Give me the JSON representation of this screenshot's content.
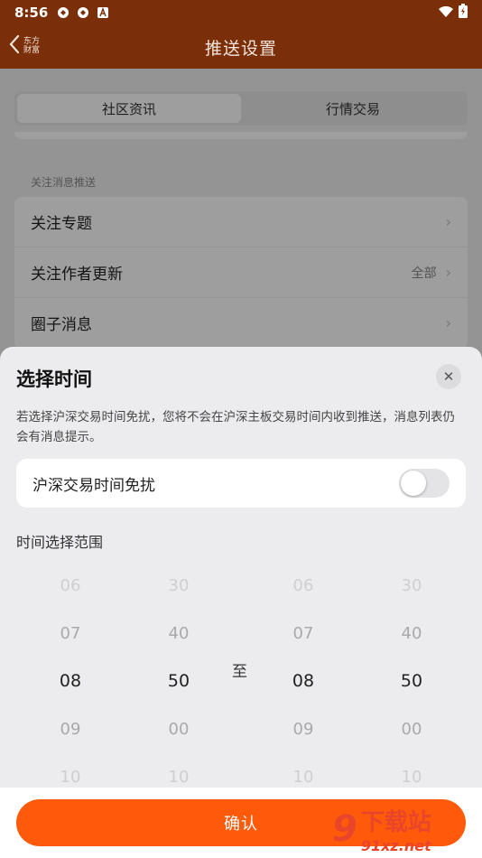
{
  "status_bar": {
    "time": "8:56"
  },
  "header": {
    "back_logo": "东方\n财富",
    "title": "推送设置"
  },
  "tabs": [
    {
      "label": "社区资讯",
      "active": true
    },
    {
      "label": "行情交易",
      "active": false
    }
  ],
  "section": {
    "label": "关注消息推送"
  },
  "list": [
    {
      "label": "关注专题",
      "value": ""
    },
    {
      "label": "关注作者更新",
      "value": "全部"
    },
    {
      "label": "圈子消息",
      "value": ""
    }
  ],
  "sheet": {
    "title": "选择时间",
    "description": "若选择沪深交易时间免扰，您将不会在沪深主板交易时间内收到推送，消息列表仍会有消息提示。",
    "toggle": {
      "label": "沪深交易时间免扰",
      "on": false
    },
    "range_label": "时间选择范围",
    "separator": "至",
    "pickers": {
      "start_hour": [
        "06",
        "07",
        "08",
        "09",
        "10"
      ],
      "start_minute": [
        "30",
        "40",
        "50",
        "00",
        "10"
      ],
      "end_hour": [
        "06",
        "07",
        "08",
        "09",
        "10"
      ],
      "end_minute": [
        "30",
        "40",
        "50",
        "00",
        "10"
      ]
    },
    "confirm_label": "确认"
  },
  "watermark": {
    "badge": "9",
    "line1": "下载站",
    "line2": "91xz.net"
  },
  "colors": {
    "header": "#7b2f08",
    "accent": "#ff5a0a",
    "watermark": "#e8452a"
  }
}
